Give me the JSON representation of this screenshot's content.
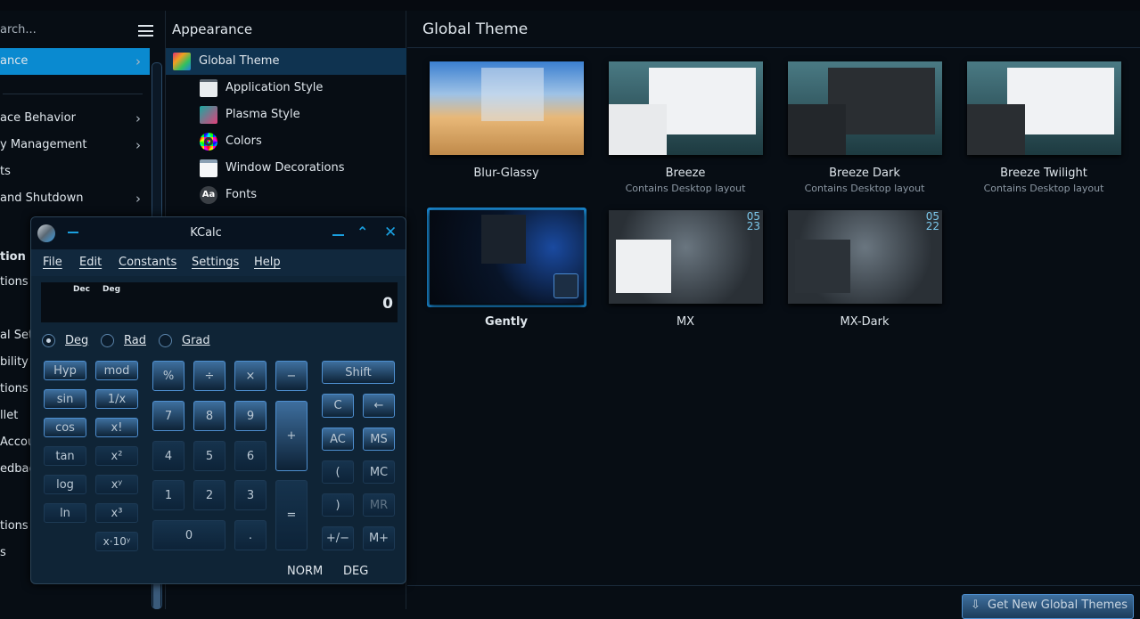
{
  "sidebar": {
    "search_placeholder": "arch...",
    "items": [
      {
        "label": "ance",
        "chevron": true,
        "selected": true
      },
      {
        "label": "ace Behavior",
        "chevron": true
      },
      {
        "label": "y Management",
        "chevron": true
      },
      {
        "label": "ts"
      },
      {
        "label": "and Shutdown",
        "chevron": true
      },
      {
        "label": "tion",
        "header": true
      },
      {
        "label": "tions"
      },
      {
        "label": "al Sett"
      },
      {
        "label": "bility"
      },
      {
        "label": "tions"
      },
      {
        "label": "llet"
      },
      {
        "label": "Accou"
      },
      {
        "label": "edbac"
      },
      {
        "label": "tions"
      },
      {
        "label": "s"
      }
    ]
  },
  "middle": {
    "title": "Appearance",
    "items": [
      "Global Theme",
      "Application Style",
      "Plasma Style",
      "Colors",
      "Window Decorations",
      "Fonts"
    ],
    "fonts_icon_text": "Aa"
  },
  "main": {
    "title": "Global Theme",
    "themes": [
      {
        "name": "Blur-Glassy",
        "sub": ""
      },
      {
        "name": "Breeze",
        "sub": "Contains Desktop layout"
      },
      {
        "name": "Breeze Dark",
        "sub": "Contains Desktop layout"
      },
      {
        "name": "Breeze Twilight",
        "sub": "Contains Desktop layout"
      },
      {
        "name": "Gently",
        "sub": "",
        "selected": true
      },
      {
        "name": "MX",
        "sub": "",
        "clock": "05 23"
      },
      {
        "name": "MX-Dark",
        "sub": "",
        "clock": "05 22"
      }
    ],
    "get_new_button": "Get New Global Themes"
  },
  "kcalc": {
    "title": "KCalc",
    "menu": [
      "File",
      "Edit",
      "Constants",
      "Settings",
      "Help"
    ],
    "display": {
      "base": "Dec",
      "angle": "Deg",
      "value": "0"
    },
    "angle_modes": [
      "Deg",
      "Rad",
      "Grad"
    ],
    "selected_angle": "Deg",
    "buttons": {
      "hyp": "Hyp",
      "mod": "mod",
      "sin": "sin",
      "inv": "1/x",
      "cos": "cos",
      "fact": "x!",
      "tan": "tan",
      "sq": "x²",
      "log": "log",
      "pow": "xʸ",
      "ln": "ln",
      "cube": "x³",
      "exp": "x·10ʸ",
      "pct": "%",
      "div": "÷",
      "mul": "×",
      "sub": "−",
      "n7": "7",
      "n8": "8",
      "n9": "9",
      "add": "+",
      "n4": "4",
      "n5": "5",
      "n6": "6",
      "n1": "1",
      "n2": "2",
      "n3": "3",
      "eq": "=",
      "n0": "0",
      "dot": ".",
      "shift": "Shift",
      "clear": "C",
      "back": "←",
      "ac": "AC",
      "ms": "MS",
      "lp": "(",
      "mc": "MC",
      "rp": ")",
      "mr": "MR",
      "neg": "+/−",
      "mplus": "M+"
    },
    "status": [
      "NORM",
      "DEG"
    ]
  },
  "colors": {
    "accent": "#0a8ad0",
    "selected_row": "#0f3350",
    "bg": "#070d14"
  }
}
